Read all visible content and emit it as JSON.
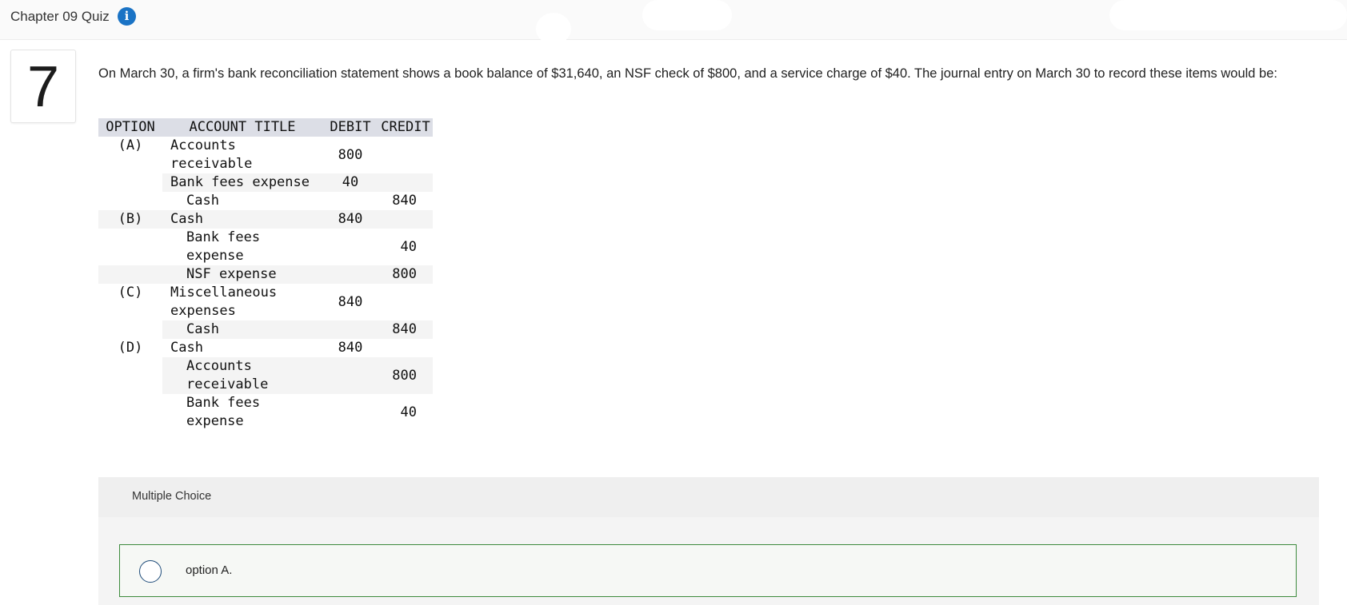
{
  "header": {
    "quiz_title": "Chapter 09 Quiz",
    "info_icon": "i"
  },
  "question": {
    "number": "7",
    "text": "On March 30, a firm's bank reconciliation statement shows a book balance of $31,640, an NSF check of $800, and a service charge of $40. The journal entry on March 30 to record these items would be:",
    "table": {
      "headers": [
        "OPTION",
        "ACCOUNT TITLE",
        "DEBIT",
        "CREDIT"
      ],
      "rows": [
        {
          "option": "(A)",
          "account": "Accounts receivable",
          "debit": "800",
          "credit": ""
        },
        {
          "option": "",
          "account": "Bank fees expense",
          "debit": "40",
          "credit": ""
        },
        {
          "option": "",
          "account": "Cash",
          "debit": "",
          "credit": "840"
        },
        {
          "option": "(B)",
          "account": "Cash",
          "debit": "840",
          "credit": ""
        },
        {
          "option": "",
          "account": "Bank fees expense",
          "debit": "",
          "credit": "40"
        },
        {
          "option": "",
          "account": "NSF expense",
          "debit": "",
          "credit": "800"
        },
        {
          "option": "(C)",
          "account": "Miscellaneous expenses",
          "debit": "840",
          "credit": ""
        },
        {
          "option": "",
          "account": "Cash",
          "debit": "",
          "credit": "840"
        },
        {
          "option": "(D)",
          "account": "Cash",
          "debit": "840",
          "credit": ""
        },
        {
          "option": "",
          "account": "Accounts receivable",
          "debit": "",
          "credit": "800"
        },
        {
          "option": "",
          "account": "Bank fees expense",
          "debit": "",
          "credit": "40"
        }
      ]
    }
  },
  "answer_section": {
    "label": "Multiple Choice",
    "options": [
      {
        "label": "option A."
      }
    ]
  },
  "colors": {
    "accent": "#1a73c5",
    "option_border": "#3c8a3c",
    "table_header_bg": "#dcdee6"
  }
}
